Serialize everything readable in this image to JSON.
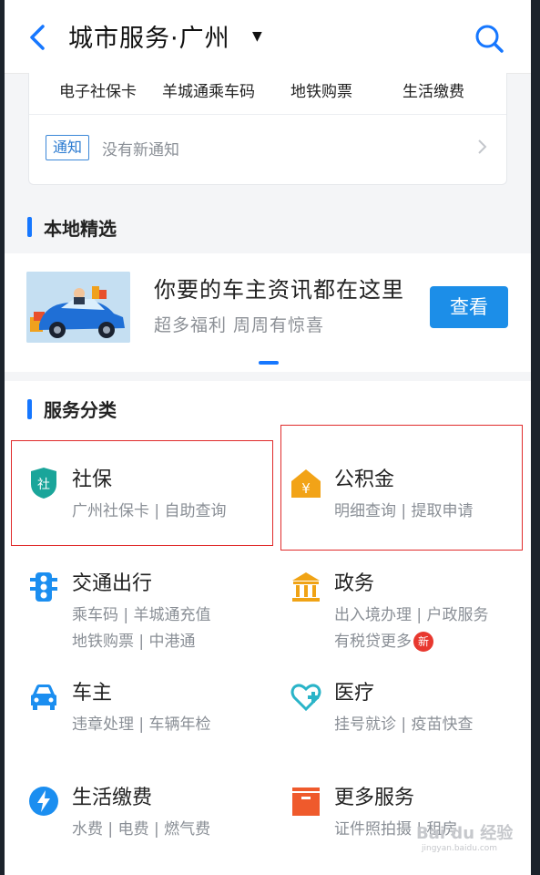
{
  "header": {
    "title": "城市服务·广州",
    "caret": "▼"
  },
  "quick_links": [
    "电子社保卡",
    "羊城通乘车码",
    "地铁购票",
    "生活缴费"
  ],
  "notice": {
    "tag": "通知",
    "text": "没有新通知"
  },
  "local_section": {
    "title": "本地精选"
  },
  "promo": {
    "title": "你要的车主资讯都在这里",
    "subtitle": "超多福利  周周有惊喜",
    "button": "查看"
  },
  "service_section": {
    "title": "服务分类"
  },
  "services": [
    {
      "name": "社保",
      "line1": "广州社保卡 | 自助查询",
      "line2": "",
      "icon": "shield-icon",
      "color": "#1aa59a"
    },
    {
      "name": "公积金",
      "line1": "明细查询 | 提取申请",
      "line2": "",
      "icon": "house-yen-icon",
      "color": "#f2a317"
    },
    {
      "name": "交通出行",
      "line1": "乘车码 | 羊城通充值",
      "line2": "地铁购票 | 中港通",
      "icon": "traffic-light-icon",
      "color": "#1b8ef0"
    },
    {
      "name": "政务",
      "line1": "出入境办理 | 户政服务",
      "line2": "有税贷更多",
      "icon": "government-building-icon",
      "color": "#f0a315"
    },
    {
      "name": "车主",
      "line1": "违章处理 | 车辆年检",
      "line2": "",
      "icon": "car-icon",
      "color": "#1b8ef0"
    },
    {
      "name": "医疗",
      "line1": "挂号就诊 | 疫苗快查",
      "line2": "",
      "icon": "medical-heart-icon",
      "color": "#2ab4c8"
    },
    {
      "name": "生活缴费",
      "line1": "水费 | 电费 | 燃气费",
      "line2": "",
      "icon": "lightning-icon",
      "color": "#1b8ef0"
    },
    {
      "name": "更多服务",
      "line1": "证件照拍摄 | 租房",
      "line2": "",
      "icon": "box-icon",
      "color": "#ef5a2c"
    }
  ],
  "new_badge": "新",
  "watermark": {
    "text": "Bai du 经验",
    "url": "jingyan.baidu.com"
  },
  "colors": {
    "accent": "#1677ff",
    "button": "#1c8ee8",
    "highlight": "#e02b2b"
  }
}
